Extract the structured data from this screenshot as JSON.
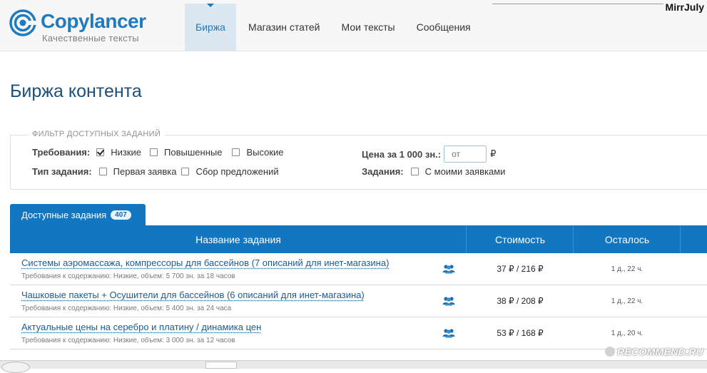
{
  "header": {
    "logo_name": "Copylancer",
    "logo_tagline": "Качественные тексты",
    "nav": [
      {
        "label": "Биржа",
        "active": true
      },
      {
        "label": "Магазин статей",
        "active": false
      },
      {
        "label": "Мои тексты",
        "active": false
      },
      {
        "label": "Сообщения",
        "active": false
      }
    ],
    "user": "MirrJuly"
  },
  "page_title": "Биржа контента",
  "filter": {
    "legend": "ФИЛЬТР ДОСТУПНЫХ ЗАДАНИЙ",
    "requirements": {
      "label": "Требования:",
      "options": [
        {
          "label": "Низкие",
          "checked": true
        },
        {
          "label": "Повышенные",
          "checked": false
        },
        {
          "label": "Высокие",
          "checked": false
        }
      ]
    },
    "task_type": {
      "label": "Тип задания:",
      "options": [
        {
          "label": "Первая заявка",
          "checked": false
        },
        {
          "label": "Сбор предложений",
          "checked": false
        }
      ]
    },
    "price": {
      "label": "Цена за 1 000 зн.:",
      "placeholder": "от",
      "currency": "₽"
    },
    "tasks": {
      "label": "Задания:",
      "option": {
        "label": "С моими заявками",
        "checked": false
      }
    }
  },
  "tab": {
    "label": "Доступные задания",
    "count": "407"
  },
  "table": {
    "columns": [
      "Название задания",
      "Стоимость",
      "Осталось"
    ],
    "rows": [
      {
        "title": "Системы аэромассажа, компрессоры для бассейнов (7 описаний для инет-магазина)",
        "details": "Требования к содержанию: Низкие, объем: 5 700 зн. за 18 часов",
        "price": "37 ₽ / 216 ₽",
        "left": "1 д., 22 ч."
      },
      {
        "title": "Чашковые пакеты + Осушители для бассейнов (6 описаний для инет-магазина)",
        "details": "Требования к содержанию: Низкие, объем: 5 400 зн. за 24 часа",
        "price": "38 ₽ / 208 ₽",
        "left": "1 д., 22 ч."
      },
      {
        "title": "Актуальные цены на серебро и платину / динамика цен",
        "details": "Требования к содержанию: Низкие, объем: 3 000 зн. за 12 часов",
        "price": "53 ₽ / 168 ₽",
        "left": "1 д., 20 ч."
      }
    ]
  },
  "watermark": "RECOMMEND.RU",
  "colors": {
    "brand": "#1f7bbf",
    "header_bg": "#1376c0",
    "nav_active_bg": "#dbe8f1"
  }
}
